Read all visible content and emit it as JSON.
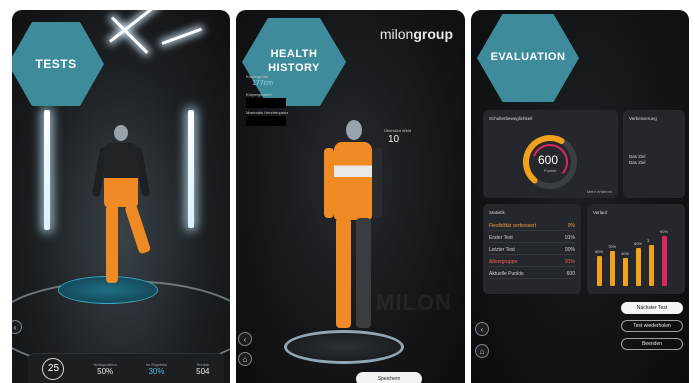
{
  "tests": {
    "title": "TESTS",
    "score": "25",
    "stats": [
      {
        "label": "Nettoposition",
        "value": "50%",
        "highlight": false
      },
      {
        "label": "Im Ergebnis",
        "value": "30%",
        "highlight": true
      },
      {
        "label": "Punkte",
        "value": "504",
        "highlight": false
      }
    ],
    "back_icon": "chevron-left-icon"
  },
  "health_history": {
    "title_line1": "HEALTH",
    "title_line2": "HISTORY",
    "logo_regular": "milon",
    "logo_bold": "group",
    "height_label": "Körpergröße",
    "height_value": "177cm",
    "weight_label": "Körpergewicht",
    "max_hr_label": "Maximale Herzfrequenz",
    "badge_label": "Übersicht Wirkt",
    "badge_value": "10",
    "watermark": "MILON",
    "bottom_button": "Speichern",
    "back_icon": "chevron-left-icon",
    "home_icon": "home-icon"
  },
  "evaluation": {
    "title": "EVALUATION",
    "gauge_card": {
      "title": "Schulterbeweglichkeit",
      "value": 600,
      "value_label": "Punkte",
      "max": 1000,
      "footer": "Mehr erfahren"
    },
    "note_card": {
      "title": "Verbesserung",
      "line1": "Das Ziel",
      "line2": "Das Ziel"
    },
    "stats_card": {
      "title": "Statistik",
      "rows": [
        {
          "label": "Flexibilität verbessert",
          "value": "0%",
          "style": "hl"
        },
        {
          "label": "Erster Test",
          "value": "91%",
          "style": ""
        },
        {
          "label": "Letzter Test",
          "value": "90%",
          "style": ""
        },
        {
          "label": "Altersgruppe",
          "value": "91%",
          "style": "red"
        },
        {
          "label": "Aktuelle Punkte",
          "value": "600",
          "style": ""
        }
      ]
    },
    "progress_card": {
      "title": "Verlauf",
      "bars": [
        {
          "label": "60%",
          "value": 60,
          "color": "#f2a11d"
        },
        {
          "label": "70%",
          "value": 70,
          "color": "#f2a11d"
        },
        {
          "label": "40%",
          "value": 55,
          "color": "#f2a11d"
        },
        {
          "label": "60%",
          "value": 75,
          "color": "#f2a11d"
        },
        {
          "label": "3",
          "value": 82,
          "color": "#f2a11d"
        },
        {
          "label": "90%",
          "value": 100,
          "color": "#e0245e"
        }
      ]
    },
    "buttons": {
      "next": "Nächster Test",
      "repeat": "Test wiederholen",
      "finish": "Beenden"
    },
    "back_icon": "chevron-left-icon",
    "home_icon": "home-icon"
  },
  "colors": {
    "accent_teal": "#3e8c9b",
    "orange": "#f2a11d",
    "red": "#e0245e"
  }
}
